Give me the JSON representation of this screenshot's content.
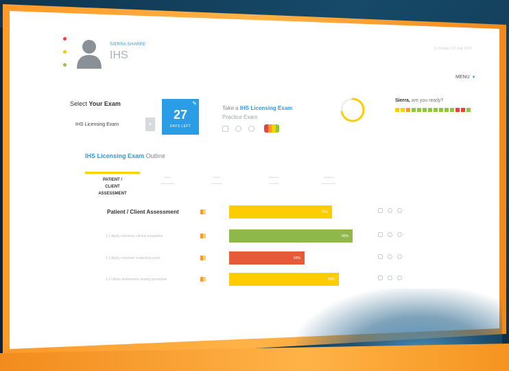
{
  "header": {
    "user_name": "SIERRA SHARPE",
    "school": "IHS",
    "top_right": "11 Private | 12 July, 2021",
    "menu_label": "MENU",
    "dot_colors": [
      "#e8443a",
      "#ffc300",
      "#8fc63d"
    ]
  },
  "exam_select": {
    "label_prefix": "Select ",
    "label_bold": "Your Exam",
    "selected_value": "IHS Licensing Exam",
    "days_number": "27",
    "days_label": "DAYS LEFT"
  },
  "practice": {
    "take_prefix": "Take a ",
    "take_bold": "IHS Licensing Exam",
    "practice_label": "Practice Exam",
    "battery_colors": [
      "#e8443a",
      "#ff9a2a",
      "#ffd000",
      "#8fc63d"
    ]
  },
  "progress_ring": {
    "value": 0.72,
    "color": "#ffcc00"
  },
  "ready": {
    "name": "Sierra,",
    "question": "are you ready?",
    "squares": [
      "#ffd000",
      "#ffd000",
      "#ff9a2a",
      "#8fc63d",
      "#8fc63d",
      "#8fc63d",
      "#8fc63d",
      "#8fc63d",
      "#8fc63d",
      "#8fc63d",
      "#8fc63d",
      "#e8443a",
      "#e8443a",
      "#8fc63d"
    ]
  },
  "outline": {
    "title_bold": "IHS Licensing Exam",
    "title_rest": " Outline",
    "active_tab": [
      "PATIENT /",
      "CLIENT",
      "ASSESSMENT"
    ],
    "rows": [
      {
        "name": "Patient / Client Assessment",
        "main": true,
        "value": 0.75,
        "label": "75%",
        "color": "#ffcc00"
      },
      {
        "name": "1.1 Apply interview, clinical evaluation",
        "main": false,
        "value": 0.9,
        "label": "90%",
        "color": "#8fb84a"
      },
      {
        "name": "1.2 Apply computer inspection proto",
        "main": false,
        "value": 0.55,
        "label": "55%",
        "color": "#e65a3a"
      },
      {
        "name": "1.3 Utilize audiometric testing procedure",
        "main": false,
        "value": 0.8,
        "label": "80%",
        "color": "#ffcc00"
      }
    ]
  }
}
